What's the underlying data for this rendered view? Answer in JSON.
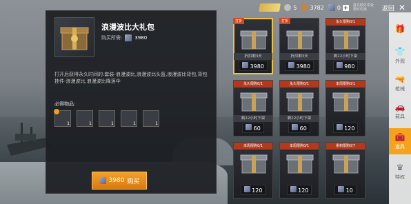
{
  "topbar": {
    "coins_value": "5",
    "bp_value": "3782",
    "uc_value": "0",
    "tiny_note": "首充额外享受\n限时优惠",
    "back_label": "返回"
  },
  "detail": {
    "title": "浪漫波比大礼包",
    "price_label": "购买所需:",
    "price_value": "3980",
    "description": "打开后获得永久时间的:套装-浪漫波比,浪漫波比头盔,浪漫波比背包,背包挂件-浪漫波比,浪漫波比降落伞",
    "included_label": "必得物品:",
    "included_items": [
      {
        "icon": "box-icon",
        "qty": "1"
      },
      {
        "icon": "helmet-icon",
        "qty": "1"
      },
      {
        "icon": "backpack-icon",
        "qty": "1"
      },
      {
        "icon": "pendant-icon",
        "qty": "1"
      },
      {
        "icon": "parachute-icon",
        "qty": "1"
      }
    ],
    "buy_price": "3980",
    "buy_label": "购买"
  },
  "grid": [
    {
      "badge": "打折",
      "head": "",
      "strip": "折扣剩3天",
      "price": "3980",
      "selected": true,
      "icon": "gift-box-icon"
    },
    {
      "badge": "打折",
      "head": "",
      "strip": "折扣剩3天",
      "price": "3980",
      "selected": false,
      "icon": "corgi-icon"
    },
    {
      "badge": "",
      "head": "永久限购0/1",
      "strip": "剩22小时下架",
      "price": "980",
      "selected": false,
      "icon": "gift-box-icon"
    },
    {
      "badge": "",
      "head": "永久限购0/1",
      "strip": "剩22小时下架",
      "price": "60",
      "selected": false,
      "icon": "chest-icon"
    },
    {
      "badge": "",
      "head": "永久限购0/1",
      "strip": "剩22小时下架",
      "price": "60",
      "selected": false,
      "icon": "chest-icon"
    },
    {
      "badge": "",
      "head": "本周限购0/1",
      "strip": "",
      "price": "120",
      "selected": false,
      "icon": "chest-icon"
    },
    {
      "badge": "",
      "head": "本周限购0/1",
      "strip": "",
      "price": "120",
      "selected": false,
      "icon": "chest-icon"
    },
    {
      "badge": "",
      "head": "本周限购0/1",
      "strip": "",
      "price": "120",
      "selected": false,
      "icon": "chest-icon"
    },
    {
      "badge": "",
      "head": "累积限购0/7",
      "strip": "",
      "price": "10",
      "selected": false,
      "icon": "chest-icon"
    }
  ],
  "tabs": [
    {
      "label": "",
      "icon": "gift-icon",
      "active": false
    },
    {
      "label": "外观",
      "icon": "hanger-icon",
      "active": false
    },
    {
      "label": "枪械",
      "icon": "gun-icon",
      "active": false
    },
    {
      "label": "载具",
      "icon": "car-icon",
      "active": false
    },
    {
      "label": "道具",
      "icon": "item-icon",
      "active": true
    },
    {
      "label": "特权",
      "icon": "crown-icon",
      "active": false
    }
  ],
  "colors": {
    "accent": "#f5a31c",
    "discount": "#d2471d",
    "panel": "#1c1e22"
  }
}
